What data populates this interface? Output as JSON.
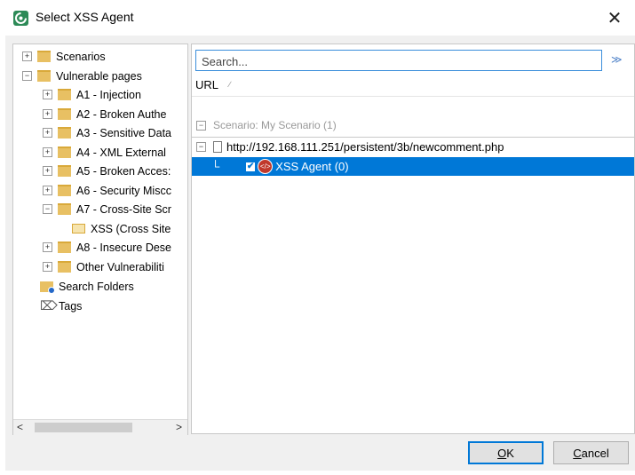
{
  "window": {
    "title": "Select XSS Agent",
    "close_glyph": "✕"
  },
  "tree": {
    "items": [
      {
        "label": "Scenarios",
        "expander": "+",
        "icon": "folder-icon"
      },
      {
        "label": "Vulnerable pages",
        "expander": "−",
        "icon": "folder-icon"
      },
      {
        "label": "A1 - Injection",
        "expander": "+",
        "icon": "folder-icon"
      },
      {
        "label": "A2 - Broken Authe",
        "expander": "+",
        "icon": "folder-icon"
      },
      {
        "label": "A3 - Sensitive Data",
        "expander": "+",
        "icon": "folder-icon"
      },
      {
        "label": "A4 - XML External",
        "expander": "+",
        "icon": "folder-icon"
      },
      {
        "label": "A5 - Broken Acces:",
        "expander": "+",
        "icon": "folder-icon"
      },
      {
        "label": "A6 - Security Miscc",
        "expander": "+",
        "icon": "folder-icon"
      },
      {
        "label": "A7 - Cross-Site Scr",
        "expander": "−",
        "icon": "folder-icon"
      },
      {
        "label": "XSS (Cross Site",
        "icon": "open-folder-icon"
      },
      {
        "label": "A8 - Insecure Dese",
        "expander": "+",
        "icon": "folder-icon"
      },
      {
        "label": "Other Vulnerabiliti",
        "expander": "+",
        "icon": "folder-icon"
      },
      {
        "label": "Search Folders",
        "icon": "search-folder-icon"
      },
      {
        "label": "Tags",
        "icon": "tag-icon"
      }
    ],
    "scroll_left": "<",
    "scroll_right": ">"
  },
  "search": {
    "placeholder": "Search...",
    "value": "",
    "expand_glyph": "≫"
  },
  "columns": {
    "url": "URL",
    "sort_glyph": "∕"
  },
  "results": {
    "group_expander": "−",
    "group_label": "Scenario: My Scenario (1)",
    "url_expander": "−",
    "url": "http://192.168.111.251/persistent/3b/newcomment.php",
    "agent_label": "XSS Agent (0)",
    "agent_checked": "✔",
    "agent_icon_text": "</>"
  },
  "buttons": {
    "ok_underline": "O",
    "ok_rest": "K",
    "cancel_underline": "C",
    "cancel_rest": "ancel"
  },
  "colors": {
    "selection": "#0078d7",
    "folder": "#e8c063",
    "accent": "#3b8edb"
  }
}
